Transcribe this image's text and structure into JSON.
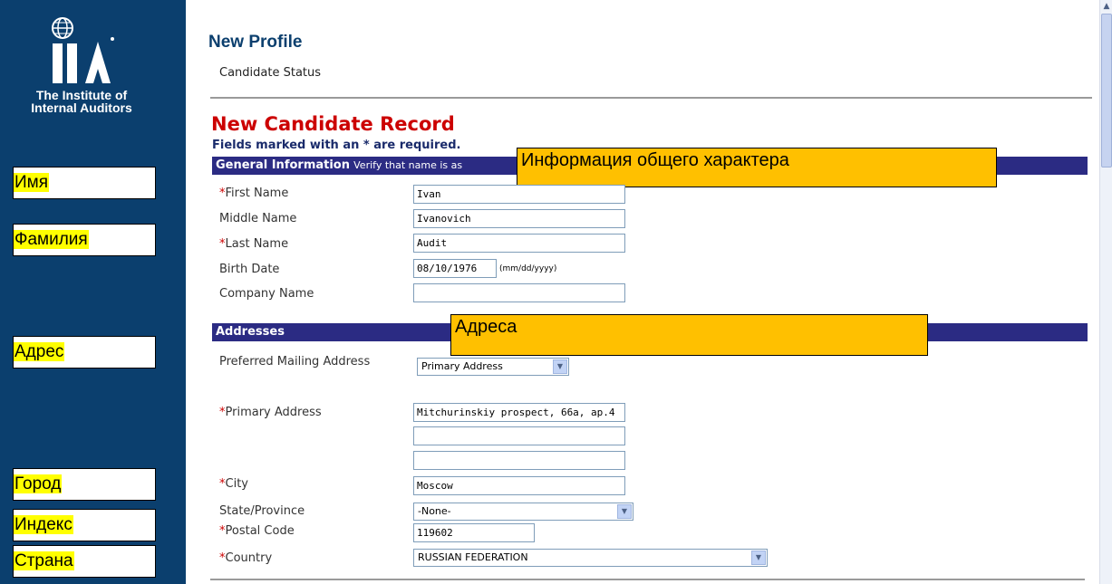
{
  "org": {
    "line1": "The Institute of",
    "line2": "Internal Auditors",
    "logo_text": "IIA"
  },
  "sidebar": {
    "labels": [
      "Имя",
      "Фамилия",
      "Адрес",
      "Город",
      "Индекс",
      "Страна"
    ]
  },
  "header": {
    "title": "New Profile",
    "status": "Candidate Status"
  },
  "record": {
    "title": "New Candidate Record",
    "required_note": "Fields marked with an * are required."
  },
  "general": {
    "section_title": "General Information",
    "section_hint": "Verify that name is as",
    "callout": "Информация общего характера",
    "fields": {
      "first_name": {
        "label": "First Name",
        "value": "Ivan"
      },
      "middle_name": {
        "label": "Middle Name",
        "value": "Ivanovich"
      },
      "last_name": {
        "label": "Last Name",
        "value": "Audit"
      },
      "birth_date": {
        "label": "Birth Date",
        "value": "08/10/1976",
        "hint": "(mm/dd/yyyy)"
      },
      "company": {
        "label": "Company Name",
        "value": ""
      }
    },
    "required_mark": "*"
  },
  "addresses": {
    "section_title": "Addresses",
    "callout": "Адреса",
    "preferred": {
      "label": "Preferred Mailing Address",
      "value": "Primary Address"
    },
    "primary": {
      "label": "Primary Address",
      "line1": "Mitchurinskiy prospect, 66a, ap.4",
      "line2": "",
      "line3": ""
    },
    "city": {
      "label": "City",
      "value": "Moscow"
    },
    "state": {
      "label": "State/Province",
      "value": "-None-"
    },
    "postal": {
      "label": "Postal Code",
      "value": "119602"
    },
    "country": {
      "label": "Country",
      "value": "RUSSIAN FEDERATION"
    }
  },
  "colors": {
    "sidebar": "#0b3f6e",
    "section_bar": "#2b2b83",
    "callout": "#ffc000",
    "highlight": "#ffff00",
    "required": "#cc0000"
  }
}
